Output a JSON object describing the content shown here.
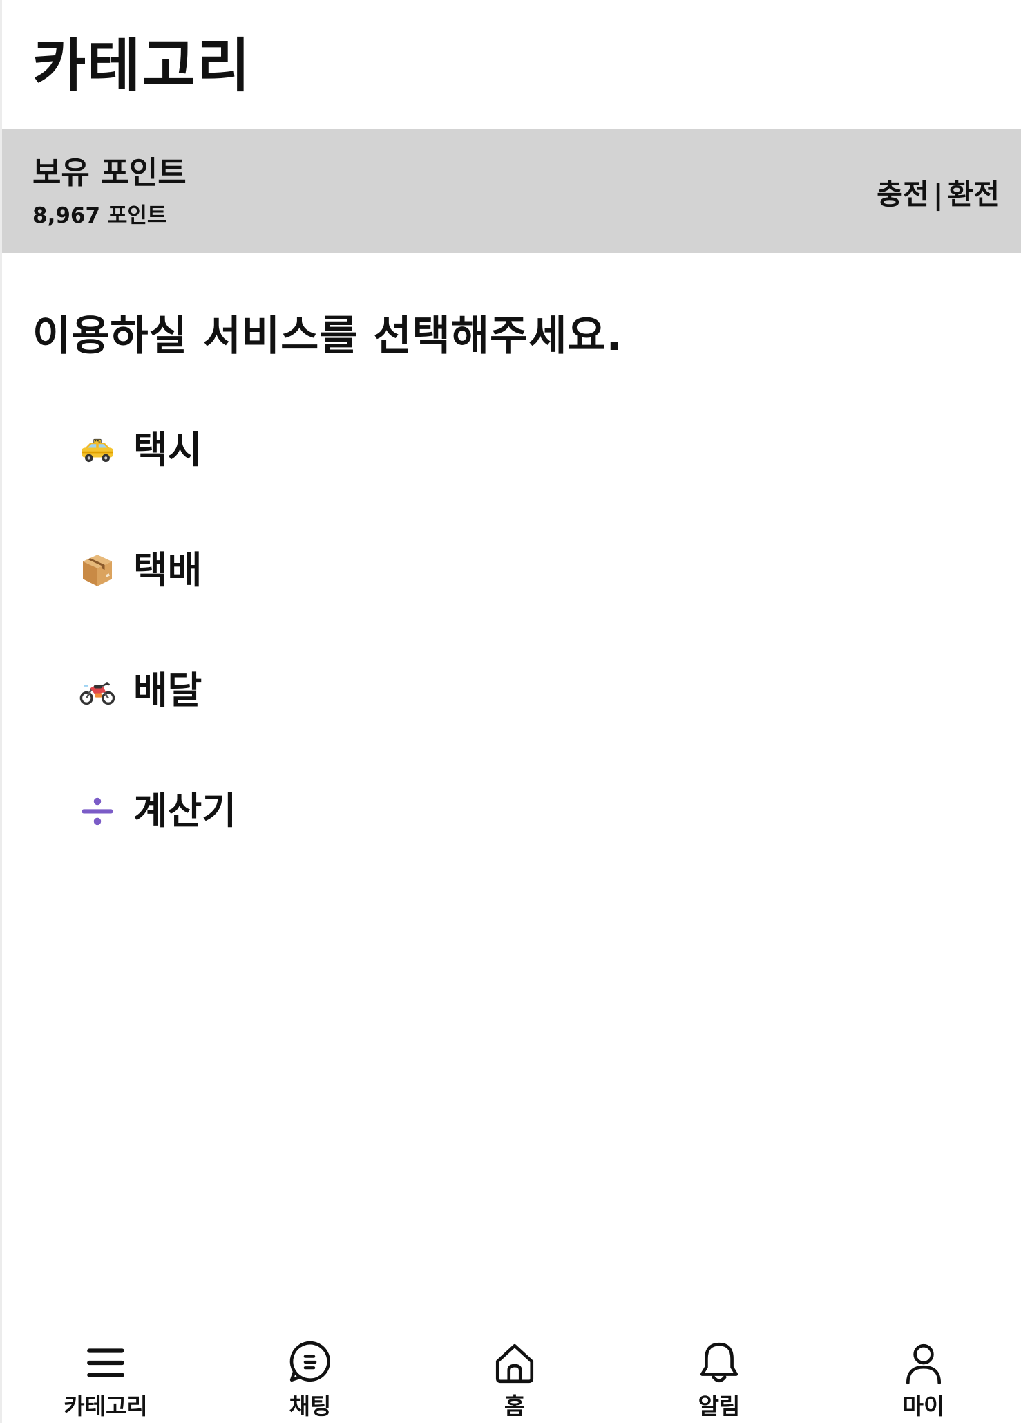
{
  "header": {
    "title": "카테고리"
  },
  "points": {
    "label": "보유 포인트",
    "value": "8,967 포인트",
    "charge_label": "충전",
    "separator": "|",
    "exchange_label": "환전",
    "bar_color": "#d3d3d3"
  },
  "main": {
    "prompt": "이용하실 서비스를 선택해주세요.",
    "services": [
      {
        "label": "택시",
        "icon": "taxi-icon"
      },
      {
        "label": "택배",
        "icon": "package-icon"
      },
      {
        "label": "배달",
        "icon": "motorcycle-icon"
      },
      {
        "label": "계산기",
        "icon": "divide-icon"
      }
    ]
  },
  "bottom_nav": {
    "items": [
      {
        "label": "카테고리",
        "icon": "menu-icon"
      },
      {
        "label": "채팅",
        "icon": "chat-icon"
      },
      {
        "label": "홈",
        "icon": "home-icon"
      },
      {
        "label": "알림",
        "icon": "bell-icon"
      },
      {
        "label": "마이",
        "icon": "user-icon"
      }
    ]
  }
}
